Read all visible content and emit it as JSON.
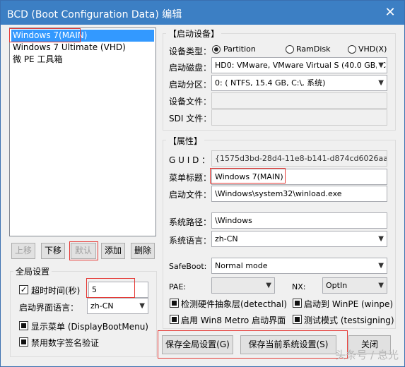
{
  "window": {
    "title": "BCD (Boot Configuration Data) 编辑",
    "close_glyph": "✕"
  },
  "entries": [
    {
      "label": "Windows 7(MAIN)",
      "selected": true
    },
    {
      "label": "Windows 7 Ultimate (VHD)",
      "selected": false
    },
    {
      "label": "微 PE 工具箱",
      "selected": false
    }
  ],
  "list_buttons": {
    "up": "上移",
    "down": "下移",
    "default": "默认",
    "add": "添加",
    "delete": "删除"
  },
  "global": {
    "group_title": "全局设置",
    "timeout_label": "超时时间(秒)",
    "timeout_value": "5",
    "lang_label": "启动界面语言：",
    "lang_value": "zh-CN",
    "show_menu_label": "显示菜单 (DisplayBootMenu)",
    "no_signing_label": "禁用数字签名验证"
  },
  "boot_device": {
    "group_title": "【启动设备】",
    "type_label": "设备类型：",
    "type_options": [
      "Partition",
      "RamDisk",
      "VHD(X)"
    ],
    "type_selected": "Partition",
    "disk_label": "启动磁盘：",
    "disk_value": "HD0: VMware, VMware Virtual S (40.0 GB, C: D",
    "partition_label": "启动分区：",
    "partition_value": "0: ( NTFS,  15.4 GB, C:\\, 系统)",
    "file_label": "设备文件：",
    "file_value": "",
    "sdi_label": "SDI 文件："
  },
  "properties": {
    "group_title": "【属性】",
    "guid_label": "G U I D ：",
    "guid_value": "{1575d3bd-28d4-11e8-b141-d874cd6026aa}",
    "menu_title_label": "菜单标题：",
    "menu_title_value": "Windows 7(MAIN)",
    "boot_file_label": "启动文件：",
    "boot_file_value": "\\Windows\\system32\\winload.exe",
    "sys_path_label": "系统路径：",
    "sys_path_value": "\\Windows",
    "sys_lang_label": "系统语言：",
    "sys_lang_value": "zh-CN",
    "safeboot_label": "SafeBoot:",
    "safeboot_value": "Normal mode",
    "pae_label": "PAE:",
    "pae_value": "",
    "nx_label": "NX:",
    "nx_value": "OptIn",
    "detect_hal_label": "检测硬件抽象层(detecthal)",
    "winpe_label": "启动到 WinPE (winpe)",
    "metro_label": "启用 Win8 Metro 启动界面",
    "testsigning_label": "测试模式 (testsigning)"
  },
  "footer": {
    "save_global": "保存全局设置(G)",
    "save_current": "保存当前系统设置(S)",
    "close": "关闭"
  },
  "watermark": "头条号 / 息光",
  "colors": {
    "titlebar": "#3c7fc4",
    "selection": "#3399ff",
    "highlight_box": "#e53935"
  }
}
